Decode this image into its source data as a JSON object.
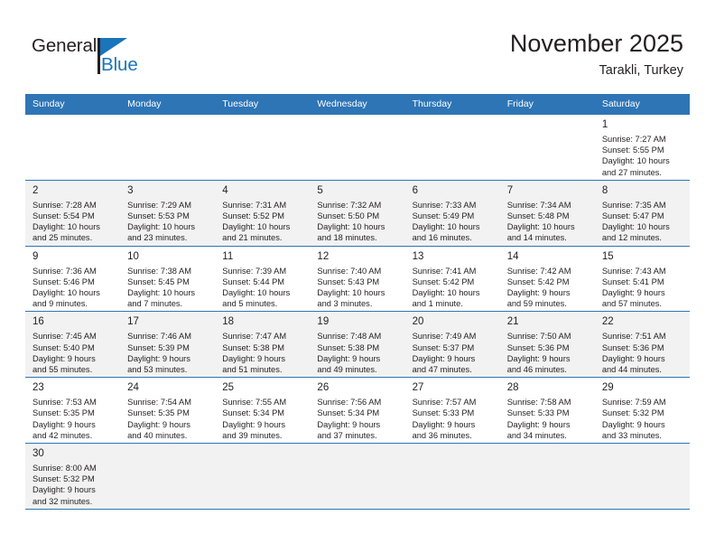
{
  "logo": {
    "word_top": "General",
    "word_bottom": "Blue",
    "accent_color": "#1b75bb",
    "text_color": "#231f20",
    "flag_icon": "triangle-flag-icon"
  },
  "header": {
    "title": "November 2025",
    "subtitle": "Tarakli, Turkey"
  },
  "theme": {
    "header_row_bg": "#2e75b6",
    "header_row_text": "#ffffff",
    "row_shade": "#f2f2f2",
    "row_plain": "#ffffff",
    "grid_line": "#2e75b6"
  },
  "weekdays": [
    "Sunday",
    "Monday",
    "Tuesday",
    "Wednesday",
    "Thursday",
    "Friday",
    "Saturday"
  ],
  "weeks": [
    [
      {
        "day": "",
        "detail": "",
        "empty": true
      },
      {
        "day": "",
        "detail": "",
        "empty": true
      },
      {
        "day": "",
        "detail": "",
        "empty": true
      },
      {
        "day": "",
        "detail": "",
        "empty": true
      },
      {
        "day": "",
        "detail": "",
        "empty": true
      },
      {
        "day": "",
        "detail": "",
        "empty": true
      },
      {
        "day": "1",
        "detail": "Sunrise: 7:27 AM\nSunset: 5:55 PM\nDaylight: 10 hours\nand 27 minutes.",
        "empty": false
      }
    ],
    [
      {
        "day": "2",
        "detail": "Sunrise: 7:28 AM\nSunset: 5:54 PM\nDaylight: 10 hours\nand 25 minutes.",
        "empty": false
      },
      {
        "day": "3",
        "detail": "Sunrise: 7:29 AM\nSunset: 5:53 PM\nDaylight: 10 hours\nand 23 minutes.",
        "empty": false
      },
      {
        "day": "4",
        "detail": "Sunrise: 7:31 AM\nSunset: 5:52 PM\nDaylight: 10 hours\nand 21 minutes.",
        "empty": false
      },
      {
        "day": "5",
        "detail": "Sunrise: 7:32 AM\nSunset: 5:50 PM\nDaylight: 10 hours\nand 18 minutes.",
        "empty": false
      },
      {
        "day": "6",
        "detail": "Sunrise: 7:33 AM\nSunset: 5:49 PM\nDaylight: 10 hours\nand 16 minutes.",
        "empty": false
      },
      {
        "day": "7",
        "detail": "Sunrise: 7:34 AM\nSunset: 5:48 PM\nDaylight: 10 hours\nand 14 minutes.",
        "empty": false
      },
      {
        "day": "8",
        "detail": "Sunrise: 7:35 AM\nSunset: 5:47 PM\nDaylight: 10 hours\nand 12 minutes.",
        "empty": false
      }
    ],
    [
      {
        "day": "9",
        "detail": "Sunrise: 7:36 AM\nSunset: 5:46 PM\nDaylight: 10 hours\nand 9 minutes.",
        "empty": false
      },
      {
        "day": "10",
        "detail": "Sunrise: 7:38 AM\nSunset: 5:45 PM\nDaylight: 10 hours\nand 7 minutes.",
        "empty": false
      },
      {
        "day": "11",
        "detail": "Sunrise: 7:39 AM\nSunset: 5:44 PM\nDaylight: 10 hours\nand 5 minutes.",
        "empty": false
      },
      {
        "day": "12",
        "detail": "Sunrise: 7:40 AM\nSunset: 5:43 PM\nDaylight: 10 hours\nand 3 minutes.",
        "empty": false
      },
      {
        "day": "13",
        "detail": "Sunrise: 7:41 AM\nSunset: 5:42 PM\nDaylight: 10 hours\nand 1 minute.",
        "empty": false
      },
      {
        "day": "14",
        "detail": "Sunrise: 7:42 AM\nSunset: 5:42 PM\nDaylight: 9 hours\nand 59 minutes.",
        "empty": false
      },
      {
        "day": "15",
        "detail": "Sunrise: 7:43 AM\nSunset: 5:41 PM\nDaylight: 9 hours\nand 57 minutes.",
        "empty": false
      }
    ],
    [
      {
        "day": "16",
        "detail": "Sunrise: 7:45 AM\nSunset: 5:40 PM\nDaylight: 9 hours\nand 55 minutes.",
        "empty": false
      },
      {
        "day": "17",
        "detail": "Sunrise: 7:46 AM\nSunset: 5:39 PM\nDaylight: 9 hours\nand 53 minutes.",
        "empty": false
      },
      {
        "day": "18",
        "detail": "Sunrise: 7:47 AM\nSunset: 5:38 PM\nDaylight: 9 hours\nand 51 minutes.",
        "empty": false
      },
      {
        "day": "19",
        "detail": "Sunrise: 7:48 AM\nSunset: 5:38 PM\nDaylight: 9 hours\nand 49 minutes.",
        "empty": false
      },
      {
        "day": "20",
        "detail": "Sunrise: 7:49 AM\nSunset: 5:37 PM\nDaylight: 9 hours\nand 47 minutes.",
        "empty": false
      },
      {
        "day": "21",
        "detail": "Sunrise: 7:50 AM\nSunset: 5:36 PM\nDaylight: 9 hours\nand 46 minutes.",
        "empty": false
      },
      {
        "day": "22",
        "detail": "Sunrise: 7:51 AM\nSunset: 5:36 PM\nDaylight: 9 hours\nand 44 minutes.",
        "empty": false
      }
    ],
    [
      {
        "day": "23",
        "detail": "Sunrise: 7:53 AM\nSunset: 5:35 PM\nDaylight: 9 hours\nand 42 minutes.",
        "empty": false
      },
      {
        "day": "24",
        "detail": "Sunrise: 7:54 AM\nSunset: 5:35 PM\nDaylight: 9 hours\nand 40 minutes.",
        "empty": false
      },
      {
        "day": "25",
        "detail": "Sunrise: 7:55 AM\nSunset: 5:34 PM\nDaylight: 9 hours\nand 39 minutes.",
        "empty": false
      },
      {
        "day": "26",
        "detail": "Sunrise: 7:56 AM\nSunset: 5:34 PM\nDaylight: 9 hours\nand 37 minutes.",
        "empty": false
      },
      {
        "day": "27",
        "detail": "Sunrise: 7:57 AM\nSunset: 5:33 PM\nDaylight: 9 hours\nand 36 minutes.",
        "empty": false
      },
      {
        "day": "28",
        "detail": "Sunrise: 7:58 AM\nSunset: 5:33 PM\nDaylight: 9 hours\nand 34 minutes.",
        "empty": false
      },
      {
        "day": "29",
        "detail": "Sunrise: 7:59 AM\nSunset: 5:32 PM\nDaylight: 9 hours\nand 33 minutes.",
        "empty": false
      }
    ],
    [
      {
        "day": "30",
        "detail": "Sunrise: 8:00 AM\nSunset: 5:32 PM\nDaylight: 9 hours\nand 32 minutes.",
        "empty": false
      },
      {
        "day": "",
        "detail": "",
        "empty": true
      },
      {
        "day": "",
        "detail": "",
        "empty": true
      },
      {
        "day": "",
        "detail": "",
        "empty": true
      },
      {
        "day": "",
        "detail": "",
        "empty": true
      },
      {
        "day": "",
        "detail": "",
        "empty": true
      },
      {
        "day": "",
        "detail": "",
        "empty": true
      }
    ]
  ]
}
